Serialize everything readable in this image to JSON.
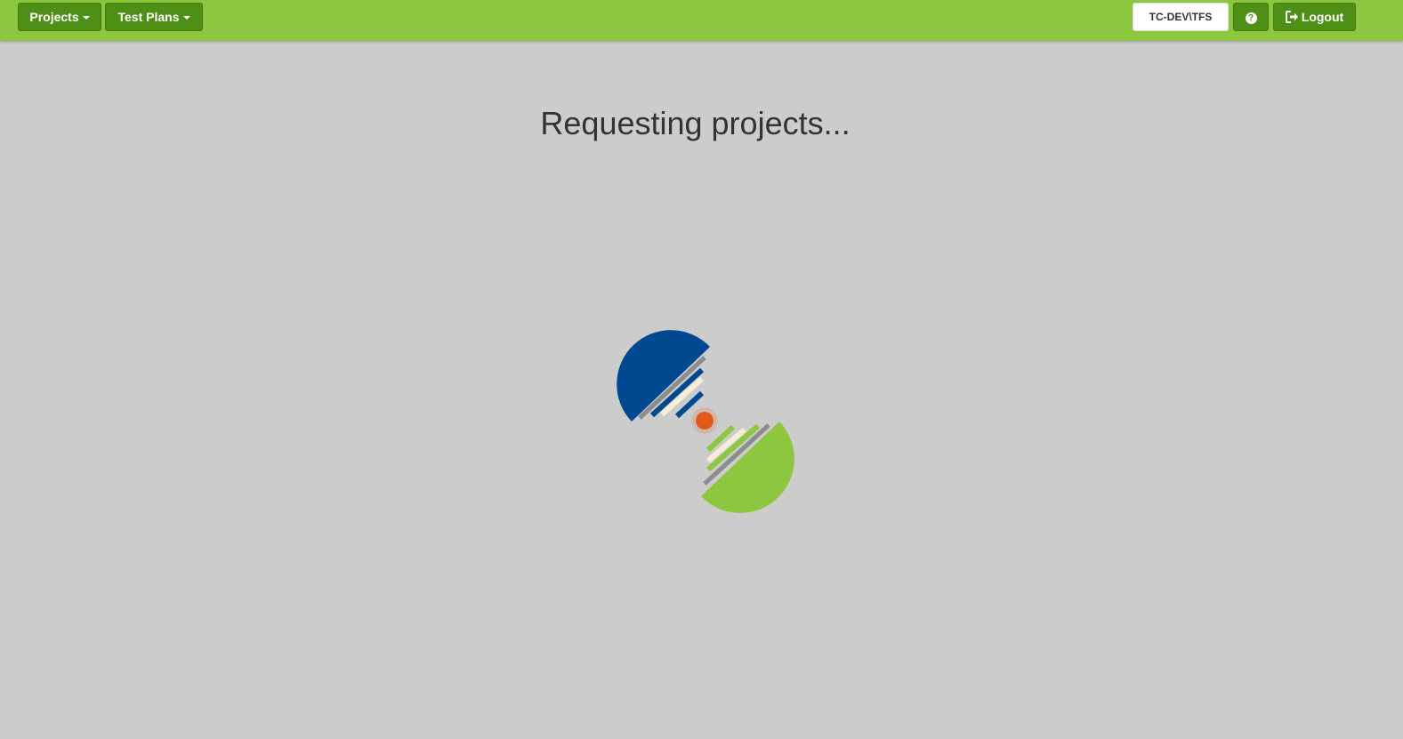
{
  "navbar": {
    "projects_label": "Projects",
    "test_plans_label": "Test Plans",
    "server_label": "TC-DEV\\TFS",
    "help_icon": "question-circle-icon",
    "logout_icon": "sign-out-icon",
    "logout_label": "Logout"
  },
  "main": {
    "status_text": "Requesting projects..."
  },
  "colors": {
    "navbar": "#8dc63f",
    "button": "#4e8f16",
    "background": "#cccccc",
    "loader_blue": "#004990",
    "loader_green": "#8dc63f",
    "loader_dot": "#e35a1c"
  }
}
